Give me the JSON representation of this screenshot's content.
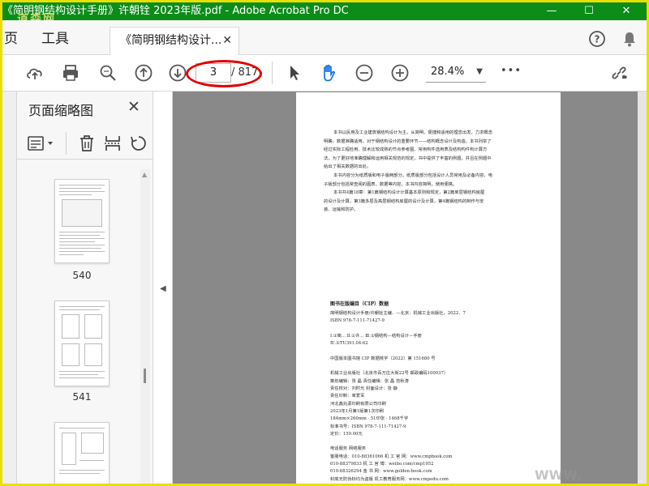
{
  "window": {
    "title": "《简明钢结构设计手册》许朝铨 2023年版.pdf - Adobe Acrobat Pro DC",
    "watermark": "道森网",
    "minimize": "—",
    "maximize": "☐",
    "close": "✕"
  },
  "menu": {
    "home": "页",
    "tools": "工具",
    "tab_label": "《简明钢结构设计...",
    "tab_close": "✕",
    "help_icon": "help-icon",
    "bell_icon": "bell-icon"
  },
  "toolbar": {
    "current_page": "3",
    "total_pages": "/ 817",
    "zoom": "28.4%",
    "zoom_caret": "▼",
    "more": "•••",
    "annotation_color": "#e00000"
  },
  "sidebar": {
    "title": "页面缩略图",
    "close": "✕",
    "thumbnails": [
      {
        "label": "540"
      },
      {
        "label": "541"
      },
      {
        "label": ""
      }
    ],
    "collapse_arrow": "◀"
  },
  "document": {
    "paragraphs": [
      "本书以民用及工业建筑钢结构设计为主，从简明、便捷和适用的理念出发，力求概念",
      "明确，数据准确适用。对于钢结构设计的重要环节——结构概念设计及构造，本书列举了",
      "经过实际工程检用、技术比较成熟的节点参考图、常用构件选用表及结构构件构计算方",
      "法，为了更好地准确理解和运用相关规范的规定，书中提供了丰富的例题，并且在例题中",
      "给出了相关数据的出处。",
      "本书内容分为纸质版和电子版两部分。纸质版部分包括设计人员常用及必备内容，电",
      "子版部分包括常查阅的图表、数据等内容。本书内容简明，使用便携。",
      "本书共4篇18章：第1篇钢结构设计计算基本原则和规定，第2篇单层钢结构房屋",
      "的设计及计算，第3篇多层及高层钢结构房屋的设计及计算，第4篇钢结构的制作与安",
      "装、运输和防护。"
    ],
    "cip_heading": "图书在版编目（CIP）数据",
    "cip_lines": [
      "简明钢结构设计手册/许朝铨主编．—北京：机械工业出版社，2022．7",
      "ISBN 978-7-111-71427-9",
      "",
      "Ⅰ.①简…   Ⅱ.①许…   Ⅲ.①钢结构－结构设计－手册",
      "Ⅳ.①TU391.04-62",
      "",
      "中国版本图书馆 CIP 数据核字（2022）第 151680 号",
      "",
      "机械工业出版社（北京市百万庄大街22号   邮政编码100037）",
      "策划编辑：张  晶   责任编辑：张  晶  范秋涛",
      "责任校对：刘时光   封面设计：张  静",
      "责任印制：单爱军",
      "河北鑫兆源印刷有限公司印刷",
      "2023年1月第1版第1次印刷",
      "184mm×260mm · 51印张 · 1468千字",
      "标准书号：ISBN 978-7-111-71427-9",
      "定价：159.00元",
      "",
      "电话服务                      网络服务",
      "客服电话：010-88361066   机  工  官  网：www.cmpbook.com",
      "              010-88379833   机  工  官  博：weibo.com/cmp1952",
      "              010-68326294   金        书        网：www.golden-book.com",
      "封底无防伪标均为盗版          机工教育服务网：www.cmpedu.com"
    ],
    "watermark_text": "WWW."
  }
}
